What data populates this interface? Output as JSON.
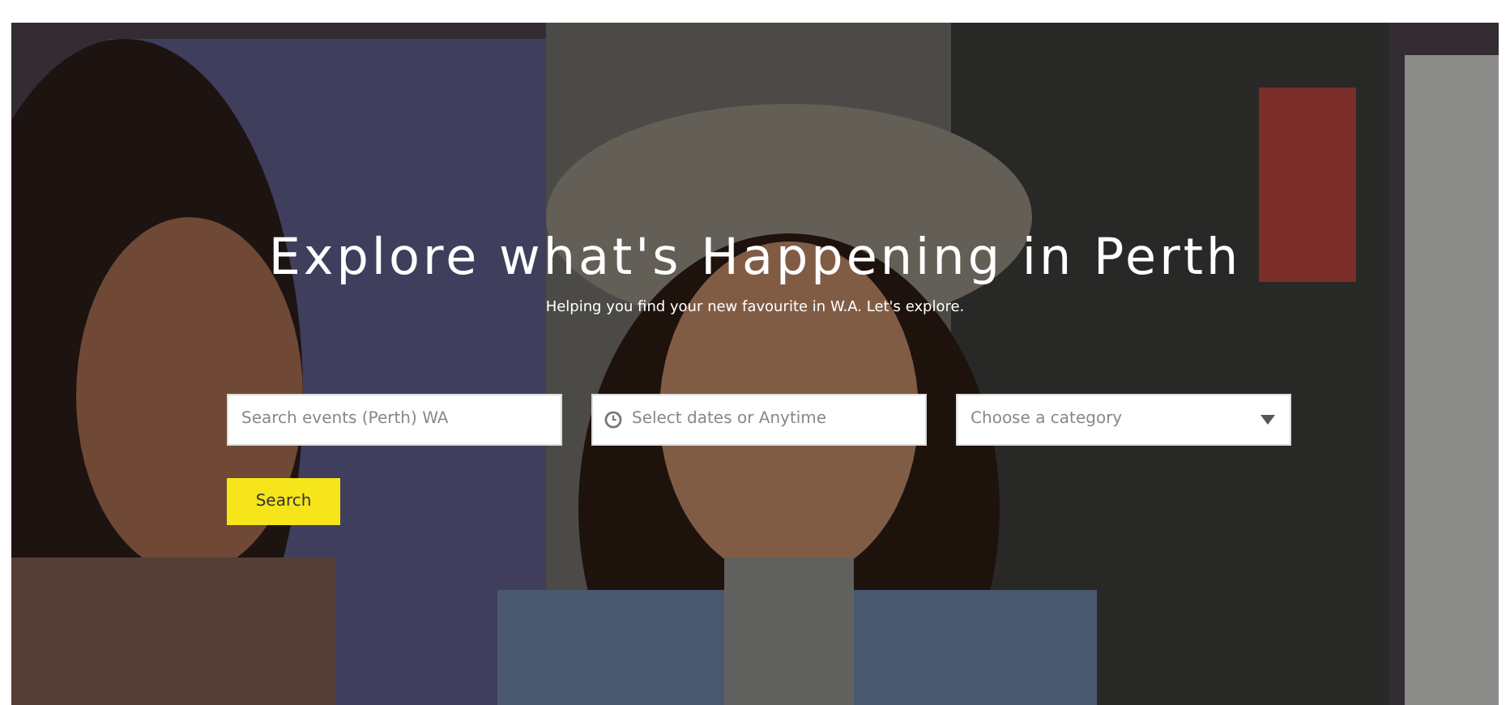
{
  "hero": {
    "title": "Explore what's Happening in Perth",
    "subtitle": "Helping you find your new favourite in W.A. Let's explore."
  },
  "search": {
    "fields": [
      {
        "kind": "text",
        "placeholder": "Search events (Perth) WA"
      },
      {
        "kind": "date",
        "placeholder": "Select dates or Anytime"
      },
      {
        "kind": "select",
        "placeholder": "Choose a category"
      }
    ],
    "button": "Search"
  }
}
